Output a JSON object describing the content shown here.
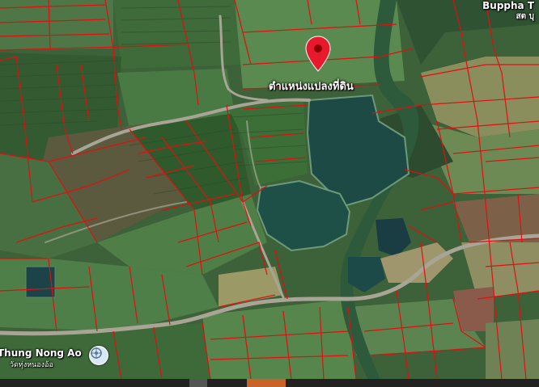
{
  "map": {
    "type": "satellite",
    "marker_label": "ตำแหน่งแปลงที่ดิน",
    "marker_icon": "location-pin-icon",
    "marker_color": "#e8192c",
    "parcel_line_color": "#e01010",
    "place_labels": {
      "top_right": "Buppha T",
      "top_right_thai": "สต บุ",
      "bottom_left": "Thung Nong Ao",
      "bottom_left_thai": "วัดทุ่งหนองอ้อ",
      "bottom_left_icon": "temple-icon"
    }
  }
}
